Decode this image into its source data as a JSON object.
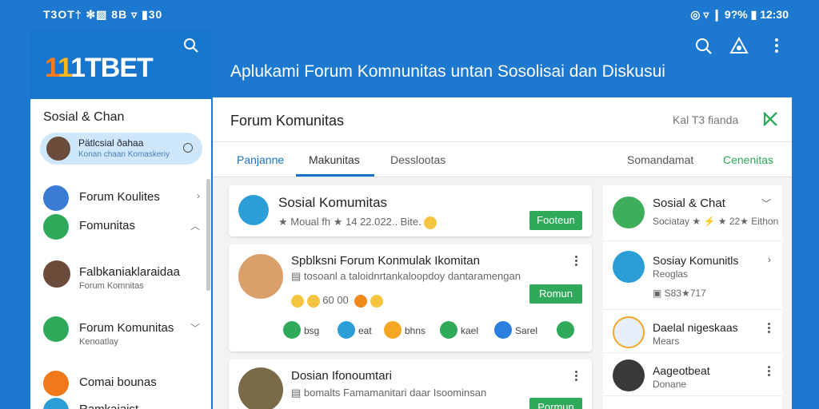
{
  "status": {
    "left": "T3OT†  ✻▨  8B  ▿  ▮30",
    "right": "◎  ▿  ❙ 9?%  ▮ 12:30"
  },
  "brand": {
    "logo_prefix1": "1",
    "logo_prefix2": "1",
    "logo_rest": "1TBET"
  },
  "headline": "Aplukami Forum Komnunitas untan Sosolisai dan Diskusui",
  "sidebar": {
    "section_title": "Sosial & Chan",
    "active": {
      "title": "Pätlcsial ðahaa",
      "subtitle": "Konan chaan Komaskeriy"
    },
    "items": [
      {
        "label": "Forum Koulites",
        "subtitle": "",
        "color": "#3a7bd5"
      },
      {
        "label": "Fomunitas",
        "subtitle": "",
        "color": "#2eaa5a"
      },
      {
        "label": "Falbkaniaklaraidaa",
        "subtitle": "Forum Komnitas",
        "color": "#6b4b3a"
      },
      {
        "label": "Forum Komunitas",
        "subtitle": "Kenoatlay",
        "color": "#2eaa5a"
      },
      {
        "label": "Comai bounas",
        "subtitle": "",
        "color": "#f07a1a"
      },
      {
        "label": "Ramkaiaist",
        "subtitle": "",
        "color": "#2b9ed8"
      }
    ]
  },
  "main": {
    "title": "Forum Komunitas",
    "header_sub": "Kal  T3 fianda",
    "tabs": [
      "Panjanne",
      "Makunitas",
      "Desslootas",
      "Somandamat",
      "Cenenitas"
    ],
    "posts": [
      {
        "title": "Sosial Komumitas",
        "meta": "★ Moual fh ★ 14 22.022.. Bite.",
        "button": "Footeun"
      },
      {
        "title": "Spblksni Forum Konmulak Ikomitan",
        "meta": "▤ tosoanl a taloidnrtankaloopdoy dantaramengan",
        "meta2": "60 00",
        "button": "Romun",
        "reactions": [
          "bsg",
          "eat",
          "bhns",
          "kael",
          "Sarel",
          ""
        ]
      },
      {
        "title": "Dosian Ifonoumtari",
        "meta": "▤ bomalts Famamanitari daar Isoominsan",
        "button": "Pormun"
      }
    ]
  },
  "side": [
    {
      "title": "Sosial & Chat",
      "sub": "Sociatay ★ ⚡ ★ 22★ Eithon"
    },
    {
      "title": "Sosiay Komunitls",
      "sub": "Reoglas",
      "sub2": "▣ S83★717"
    },
    {
      "title": "Daelal nigeskaas",
      "sub": "Mears"
    },
    {
      "title": "Aageotbeat",
      "sub": "Donane"
    }
  ],
  "colors": {
    "accent": "#1a73c9",
    "green": "#2eaa5a",
    "bg": "#1d78cf"
  }
}
